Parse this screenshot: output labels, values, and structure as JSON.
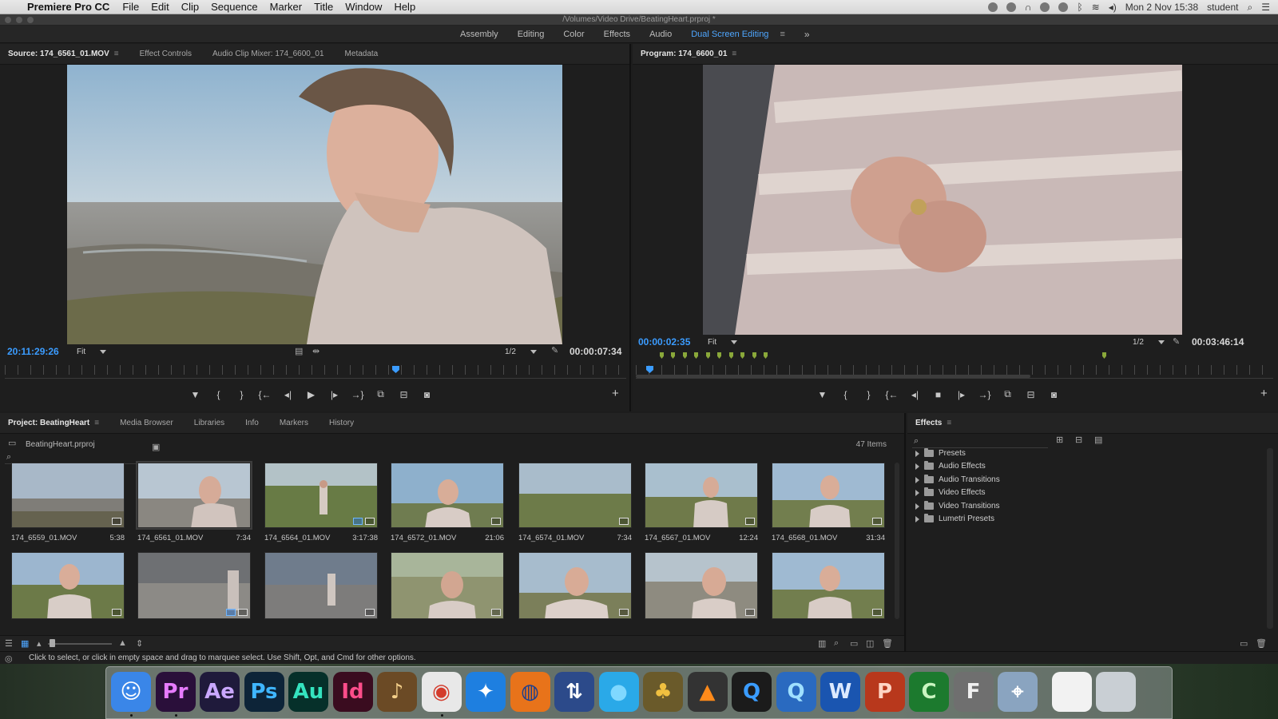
{
  "menubar": {
    "app_name": "Premiere Pro CC",
    "items": [
      "File",
      "Edit",
      "Clip",
      "Sequence",
      "Marker",
      "Title",
      "Window",
      "Help"
    ],
    "clock": "Mon 2 Nov  15:38",
    "user": "student"
  },
  "window": {
    "title": "/Volumes/Video Drive/BeatingHeart.prproj *"
  },
  "workspaces": {
    "items": [
      "Assembly",
      "Editing",
      "Color",
      "Effects",
      "Audio",
      "Dual Screen Editing"
    ],
    "active": "Dual Screen Editing",
    "more": "»"
  },
  "source": {
    "tabs": [
      "Source: 174_6561_01.MOV",
      "Effect Controls",
      "Audio Clip Mixer: 174_6600_01",
      "Metadata"
    ],
    "timecode": "20:11:29:26",
    "zoom": "Fit",
    "resolution": "1/2",
    "duration": "00:00:07:34"
  },
  "program": {
    "tabs": [
      "Program: 174_6600_01"
    ],
    "timecode": "00:00:02:35",
    "zoom": "Fit",
    "resolution": "1/2",
    "duration": "00:03:46:14"
  },
  "controls": {
    "marker": "▼",
    "in": "{",
    "out": "}",
    "goto_in": "{←",
    "step_back": "◂|",
    "play": "▶",
    "stop": "■",
    "step_fwd": "|▸",
    "goto_out": "→}",
    "insert": "⧉",
    "overwrite": "⊟",
    "export": "◙",
    "add": "+"
  },
  "project": {
    "tabs": [
      "Project: BeatingHeart",
      "Media Browser",
      "Libraries",
      "Info",
      "Markers",
      "History"
    ],
    "file": "BeatingHeart.prproj",
    "count": "47 Items",
    "clips": [
      {
        "name": "174_6559_01.MOV",
        "duration": "5:38"
      },
      {
        "name": "174_6561_01.MOV",
        "duration": "7:34"
      },
      {
        "name": "174_6564_01.MOV",
        "duration": "3:17:38"
      },
      {
        "name": "174_6572_01.MOV",
        "duration": "21:06"
      },
      {
        "name": "174_6574_01.MOV",
        "duration": "7:34"
      },
      {
        "name": "174_6567_01.MOV",
        "duration": "12:24"
      },
      {
        "name": "174_6568_01.MOV",
        "duration": "31:34"
      }
    ]
  },
  "effects": {
    "tab": "Effects",
    "folders": [
      "Presets",
      "Audio Effects",
      "Audio Transitions",
      "Video Effects",
      "Video Transitions",
      "Lumetri Presets"
    ]
  },
  "status": {
    "text": "Click to select, or click in empty space and drag to marquee select. Use Shift, Opt, and Cmd for other options."
  },
  "dock": {
    "apps": [
      {
        "name": "finder",
        "label": "☺",
        "bg": "#3a86e8",
        "fg": "#ffffff"
      },
      {
        "name": "premiere",
        "label": "Pr",
        "bg": "#2a0f3a",
        "fg": "#e77bff"
      },
      {
        "name": "after-effects",
        "label": "Ae",
        "bg": "#1f1a3b",
        "fg": "#c9a7ff"
      },
      {
        "name": "photoshop",
        "label": "Ps",
        "bg": "#0d2438",
        "fg": "#3fb6ff"
      },
      {
        "name": "audition",
        "label": "Au",
        "bg": "#06302a",
        "fg": "#34e3bf"
      },
      {
        "name": "indesign",
        "label": "Id",
        "bg": "#3a0c1f",
        "fg": "#ff4d8a"
      },
      {
        "name": "garageband",
        "label": "♪",
        "bg": "#6b4a25",
        "fg": "#f5d08a"
      },
      {
        "name": "chrome",
        "label": "◉",
        "bg": "#e8e8e8",
        "fg": "#d33b2c"
      },
      {
        "name": "safari",
        "label": "✦",
        "bg": "#1e7fe0",
        "fg": "#ffffff"
      },
      {
        "name": "firefox",
        "label": "◍",
        "bg": "#e8731a",
        "fg": "#1d3f8f"
      },
      {
        "name": "sync",
        "label": "⇅",
        "bg": "#2c4a8a",
        "fg": "#ffffff"
      },
      {
        "name": "bubble",
        "label": "●",
        "bg": "#2aa9e8",
        "fg": "#7fd8ff"
      },
      {
        "name": "drinks",
        "label": "♣",
        "bg": "#6a5a2a",
        "fg": "#f0c040"
      },
      {
        "name": "vlc",
        "label": "▲",
        "bg": "#333333",
        "fg": "#ff8a1a"
      },
      {
        "name": "quicktime",
        "label": "Q",
        "bg": "#1b1b1b",
        "fg": "#3a9cff"
      },
      {
        "name": "quick-search",
        "label": "Q",
        "bg": "#2a6ac0",
        "fg": "#9fe0ff"
      },
      {
        "name": "word",
        "label": "W",
        "bg": "#1a55b0",
        "fg": "#dce9ff"
      },
      {
        "name": "powerpoint",
        "label": "P",
        "bg": "#b8381c",
        "fg": "#ffd5c4"
      },
      {
        "name": "camtasia",
        "label": "C",
        "bg": "#1c7a2e",
        "fg": "#c9f5c0"
      },
      {
        "name": "font-book",
        "label": "F",
        "bg": "#6f6f6f",
        "fg": "#f0f0f0"
      },
      {
        "name": "preview",
        "label": "⌖",
        "bg": "#8aa4c0",
        "fg": "#ffffff"
      },
      {
        "name": "document",
        "label": "",
        "bg": "#f2f2f2",
        "fg": "#333333"
      },
      {
        "name": "trash",
        "label": "",
        "bg": "#c9cfd4",
        "fg": "#333333"
      }
    ]
  }
}
